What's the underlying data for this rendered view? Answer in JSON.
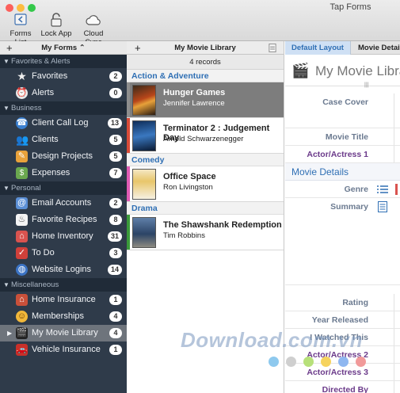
{
  "window": {
    "title": "Tap Forms"
  },
  "toolbar": {
    "forms_list": "Forms List",
    "lock_app": "Lock App",
    "cloud_sync": "Cloud Sync"
  },
  "sidebar": {
    "header": "My Forms ⌃",
    "add": "+",
    "sections": [
      {
        "label": "Favorites & Alerts",
        "items": [
          {
            "label": "Favorites",
            "count": "2",
            "icon": "star-icon"
          },
          {
            "label": "Alerts",
            "count": "0",
            "icon": "alarm-icon"
          }
        ]
      },
      {
        "label": "Business",
        "items": [
          {
            "label": "Client Call Log",
            "count": "13",
            "icon": "phone-icon"
          },
          {
            "label": "Clients",
            "count": "5",
            "icon": "people-icon"
          },
          {
            "label": "Design Projects",
            "count": "5",
            "icon": "pencil-icon"
          },
          {
            "label": "Expenses",
            "count": "7",
            "icon": "money-icon"
          }
        ]
      },
      {
        "label": "Personal",
        "items": [
          {
            "label": "Email Accounts",
            "count": "2",
            "icon": "at-icon"
          },
          {
            "label": "Favorite Recipes",
            "count": "8",
            "icon": "chef-icon"
          },
          {
            "label": "Home Inventory",
            "count": "31",
            "icon": "house-icon"
          },
          {
            "label": "To Do",
            "count": "3",
            "icon": "checkbox-icon"
          },
          {
            "label": "Website Logins",
            "count": "14",
            "icon": "globe-icon"
          }
        ]
      },
      {
        "label": "Miscellaneous",
        "items": [
          {
            "label": "Home Insurance",
            "count": "1",
            "icon": "house-icon"
          },
          {
            "label": "Memberships",
            "count": "4",
            "icon": "smiley-icon"
          },
          {
            "label": "My Movie Library",
            "count": "4",
            "icon": "clapper-icon"
          },
          {
            "label": "Vehicle Insurance",
            "count": "1",
            "icon": "car-icon"
          }
        ]
      }
    ]
  },
  "list": {
    "add": "+",
    "title": "My Movie Library",
    "count_text": "4 records",
    "groups": [
      {
        "label": "Action & Adventure",
        "records": [
          {
            "title": "Hunger Games",
            "subtitle": "Jennifer Lawrence",
            "color": "#8e8e8e"
          },
          {
            "title": "Terminator 2 : Judgement Day",
            "subtitle": "Arnold Schwarzenegger",
            "color": "#d84a38"
          }
        ]
      },
      {
        "label": "Comedy",
        "records": [
          {
            "title": "Office Space",
            "subtitle": "Ron Livingston",
            "color": "#e05bb4"
          }
        ]
      },
      {
        "label": "Drama",
        "records": [
          {
            "title": "The Shawshank Redemption",
            "subtitle": "Tim Robbins",
            "color": "#3a9a3a"
          }
        ]
      }
    ]
  },
  "detail": {
    "tab_default": "Default Layout",
    "tab_movie": "Movie Details",
    "title": "My Movie Library",
    "fields_top": [
      "Case Cover",
      "Movie Title",
      "Actor/Actress 1"
    ],
    "section": "Movie Details",
    "fields_mid": [
      "Genre",
      "Summary"
    ],
    "fields_bottom": [
      "Rating",
      "Year Released",
      "I Watched This",
      "Actor/Actress 2",
      "Actor/Actress 3",
      "Directed By"
    ]
  },
  "colors": {
    "accent": "#2f6fb4",
    "sidebar_bg": "#2f3b4a",
    "label": "#6b7a90"
  },
  "watermark": "Download.com.vn"
}
